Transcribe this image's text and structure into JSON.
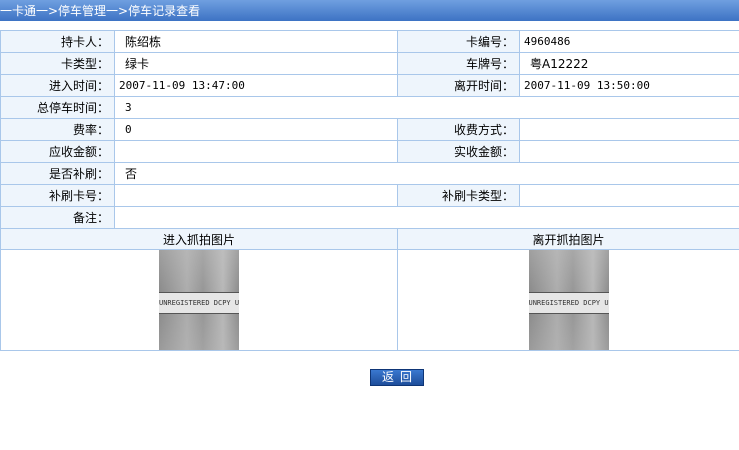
{
  "breadcrumb": "一卡通一>停车管理一>停车记录查看",
  "fields": {
    "holder_label": "持卡人：",
    "holder": "陈绍栋",
    "card_no_label": "卡编号：",
    "card_no": "4960486",
    "card_type_label": "卡类型：",
    "card_type": "绿卡",
    "plate_label": "车牌号：",
    "plate": "粤A12222",
    "enter_label": "进入时间：",
    "enter_time": "2007-11-09 13:47:00",
    "leave_label": "离开时间：",
    "leave_time": "2007-11-09 13:50:00",
    "total_label": "总停车时间：",
    "total_time": "3",
    "rate_label": "费率：",
    "rate": "0",
    "method_label": "收费方式：",
    "method": "",
    "due_label": "应收金额：",
    "due": "",
    "paid_label": "实收金额：",
    "paid": "",
    "reswipe_label": "是否补刷：",
    "reswipe": "否",
    "reswipe_card_label": "补刷卡号：",
    "reswipe_card": "",
    "reswipe_type_label": "补刷卡类型：",
    "reswipe_type": "",
    "remark_label": "备注：",
    "remark": ""
  },
  "photos": {
    "enter_title": "进入抓拍图片",
    "leave_title": "离开抓拍图片",
    "watermark": "UNREGISTERED DCPY UNREG"
  },
  "back_button": "返回"
}
